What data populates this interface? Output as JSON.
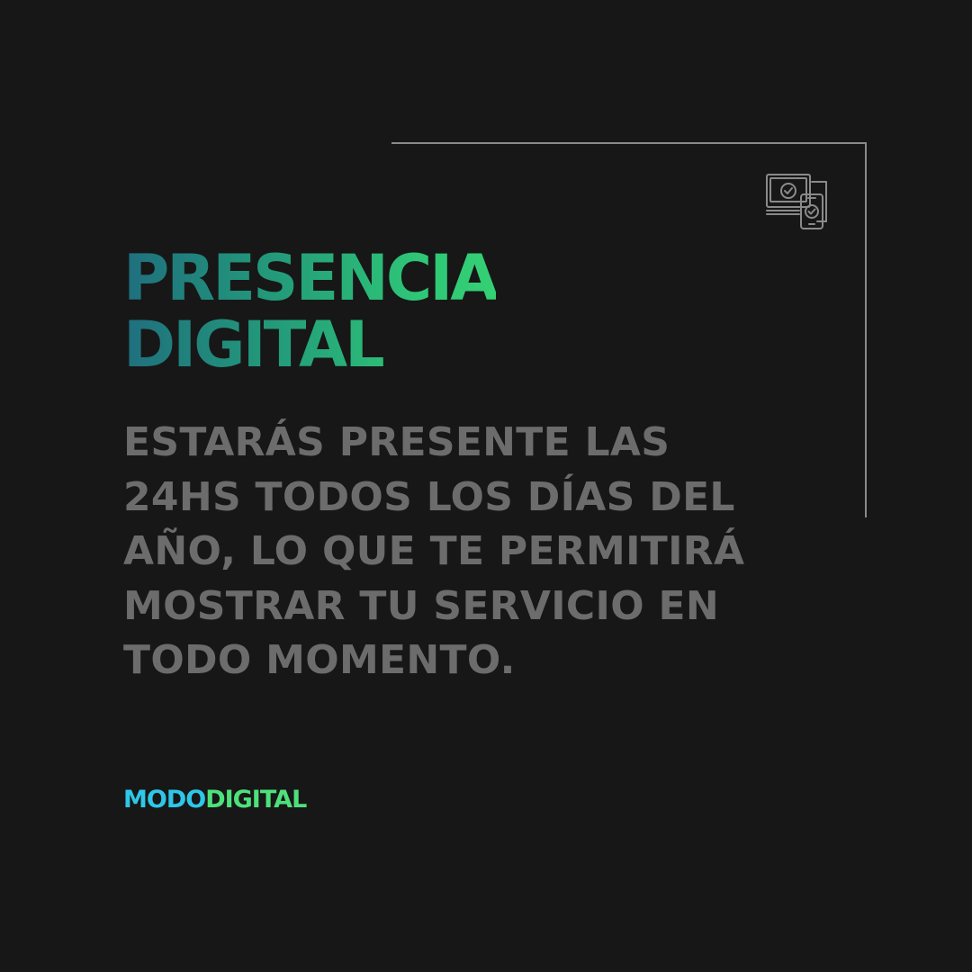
{
  "headline": {
    "line_1": "PRESENCIA",
    "line_2": "DIGITAL",
    "gradient_colors": [
      "#1f6f7e",
      "#239a7a",
      "#2fc777",
      "#34d074"
    ]
  },
  "body": {
    "lines": [
      "ESTARÁS PRESENTE LAS",
      "24HS TODOS LOS DÍAS DEL",
      "AÑO, LO QUE TE PERMITIRÁ",
      "MOSTRAR TU SERVICIO EN",
      "TODO MOMENTO."
    ],
    "color": "#6c6c6c"
  },
  "brand": {
    "part_1": "MODO",
    "part_2": "DIGITAL",
    "part_1_color": "#2ec7e8",
    "part_2_color": "#4ee07a"
  },
  "icon": {
    "name": "devices-check-icon"
  },
  "colors": {
    "background": "#171717",
    "frame_line": "#8a8a8a"
  }
}
